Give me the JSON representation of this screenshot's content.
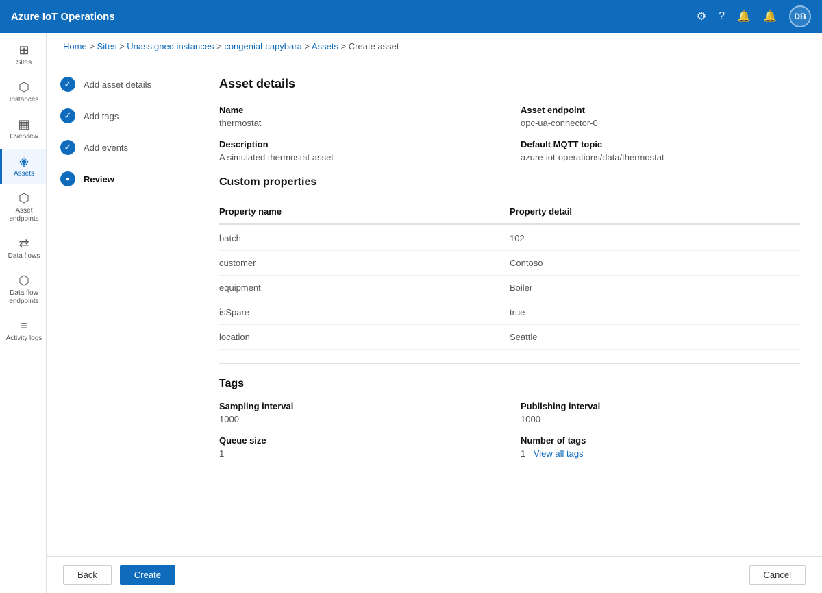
{
  "app": {
    "title": "Azure IoT Operations"
  },
  "topnav": {
    "title": "Azure IoT Operations",
    "icons": [
      "settings",
      "help",
      "bell",
      "notification"
    ],
    "avatar": "DB"
  },
  "breadcrumb": {
    "items": [
      "Home",
      "Sites",
      "Unassigned instances",
      "congenial-capybara",
      "Assets",
      "Create asset"
    ],
    "separators": [
      ">",
      ">",
      ">",
      ">",
      ">"
    ]
  },
  "wizard": {
    "steps": [
      {
        "id": "add-asset-details",
        "label": "Add asset details",
        "state": "completed"
      },
      {
        "id": "add-tags",
        "label": "Add tags",
        "state": "completed"
      },
      {
        "id": "add-events",
        "label": "Add events",
        "state": "completed"
      },
      {
        "id": "review",
        "label": "Review",
        "state": "active"
      }
    ]
  },
  "assetDetails": {
    "sectionTitle": "Asset details",
    "name": {
      "label": "Name",
      "value": "thermostat"
    },
    "assetEndpoint": {
      "label": "Asset endpoint",
      "value": "opc-ua-connector-0"
    },
    "description": {
      "label": "Description",
      "value": "A simulated thermostat asset"
    },
    "defaultMqttTopic": {
      "label": "Default MQTT topic",
      "value": "azure-iot-operations/data/thermostat"
    }
  },
  "customProperties": {
    "sectionTitle": "Custom properties",
    "headers": {
      "propertyName": "Property name",
      "propertyDetail": "Property detail"
    },
    "rows": [
      {
        "key": "batch",
        "value": "102"
      },
      {
        "key": "customer",
        "value": "Contoso"
      },
      {
        "key": "equipment",
        "value": "Boiler"
      },
      {
        "key": "isSpare",
        "value": "true"
      },
      {
        "key": "location",
        "value": "Seattle"
      }
    ]
  },
  "tags": {
    "sectionTitle": "Tags",
    "samplingInterval": {
      "label": "Sampling interval",
      "value": "1000"
    },
    "publishingInterval": {
      "label": "Publishing interval",
      "value": "1000"
    },
    "queueSize": {
      "label": "Queue size",
      "value": "1"
    },
    "numberOfTags": {
      "label": "Number of tags",
      "value": "1"
    },
    "viewAllLink": "View all tags"
  },
  "sidebar": {
    "items": [
      {
        "id": "sites",
        "label": "Sites",
        "icon": "⊞"
      },
      {
        "id": "instances",
        "label": "Instances",
        "icon": "⬡"
      },
      {
        "id": "overview",
        "label": "Overview",
        "icon": "▦"
      },
      {
        "id": "assets",
        "label": "Assets",
        "icon": "◈"
      },
      {
        "id": "asset-endpoints",
        "label": "Asset endpoints",
        "icon": "⬡"
      },
      {
        "id": "data-flows",
        "label": "Data flows",
        "icon": "⇄"
      },
      {
        "id": "data-flow-endpoints",
        "label": "Data flow endpoints",
        "icon": "⬡"
      },
      {
        "id": "activity-logs",
        "label": "Activity logs",
        "icon": "≡"
      }
    ]
  },
  "footer": {
    "backLabel": "Back",
    "createLabel": "Create",
    "cancelLabel": "Cancel"
  }
}
